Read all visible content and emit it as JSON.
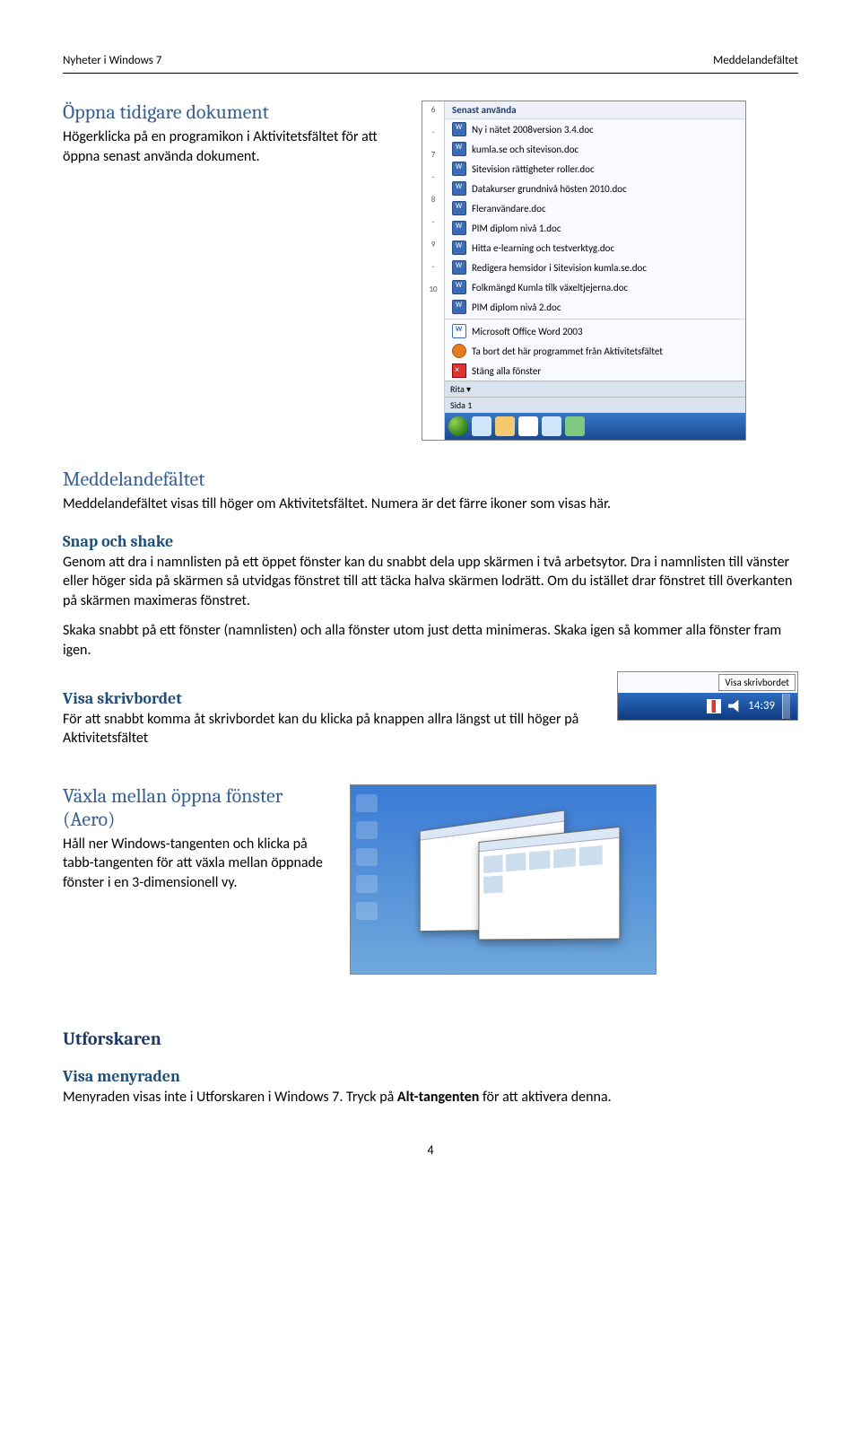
{
  "header": {
    "left": "Nyheter i Windows 7",
    "right": "Meddelandefältet"
  },
  "sec1": {
    "title": "Öppna tidigare dokument",
    "p1": "Högerklicka på en programikon i Aktivitetsfältet för att öppna senast använda dokument."
  },
  "jumplist": {
    "header": "Senast använda",
    "items": [
      "Ny i nätet 2008version 3.4.doc",
      "kumla.se och sitevison.doc",
      "Sitevision rättigheter roller.doc",
      "Datakurser grundnivå hösten 2010.doc",
      "Fleranvändare.doc",
      "PIM diplom nivå 1.doc",
      "Hitta e-learning och testverktyg.doc",
      "Redigera hemsidor i Sitevision kumla.se.doc",
      "Folkmängd Kumla tilk växeltjejerna.doc",
      "PIM diplom nivå 2.doc"
    ],
    "appline": "Microsoft Office Word 2003",
    "unpin": "Ta bort det här programmet från Aktivitetsfältet",
    "closeall": "Stäng alla fönster",
    "status_left": "Sida 1",
    "draw_btn": "Rita"
  },
  "sec2": {
    "title": "Meddelandefältet",
    "p1": "Meddelandefältet visas till höger om Aktivitetsfältet. Numera är det färre ikoner som visas här."
  },
  "sec3": {
    "title": "Snap och shake",
    "p1": "Genom att dra i namnlisten på ett öppet fönster kan du snabbt dela upp skärmen i två arbetsytor. Dra i namnlisten till vänster eller höger sida på skärmen så utvidgas fönstret till att täcka halva skärmen lodrätt. Om du istället drar fönstret till överkanten på skärmen maximeras fönstret.",
    "p2": "Skaka snabbt på ett fönster (namnlisten) och alla fönster utom just detta minimeras. Skaka igen så kommer alla fönster fram igen."
  },
  "sec4": {
    "title": "Visa skrivbordet",
    "p1": "För att snabbt komma åt skrivbordet kan du klicka på knappen allra längst ut till höger på Aktivitetsfältet"
  },
  "tray": {
    "tooltip": "Visa skrivbordet",
    "time": "14:39"
  },
  "sec5": {
    "title": "Växla mellan öppna fönster (Aero)",
    "p1": "Håll ner Windows-tangenten och klicka på tabb-tangenten för att växla mellan öppnade fönster i en 3-dimensionell vy."
  },
  "sec6": {
    "title": "Utforskaren"
  },
  "sec7": {
    "title": "Visa menyraden",
    "p1_a": "Menyraden visas inte i Utforskaren i Windows 7. Tryck på ",
    "p1_bold": "Alt-tangenten",
    "p1_b": " för att aktivera denna."
  },
  "pagenum": "4"
}
